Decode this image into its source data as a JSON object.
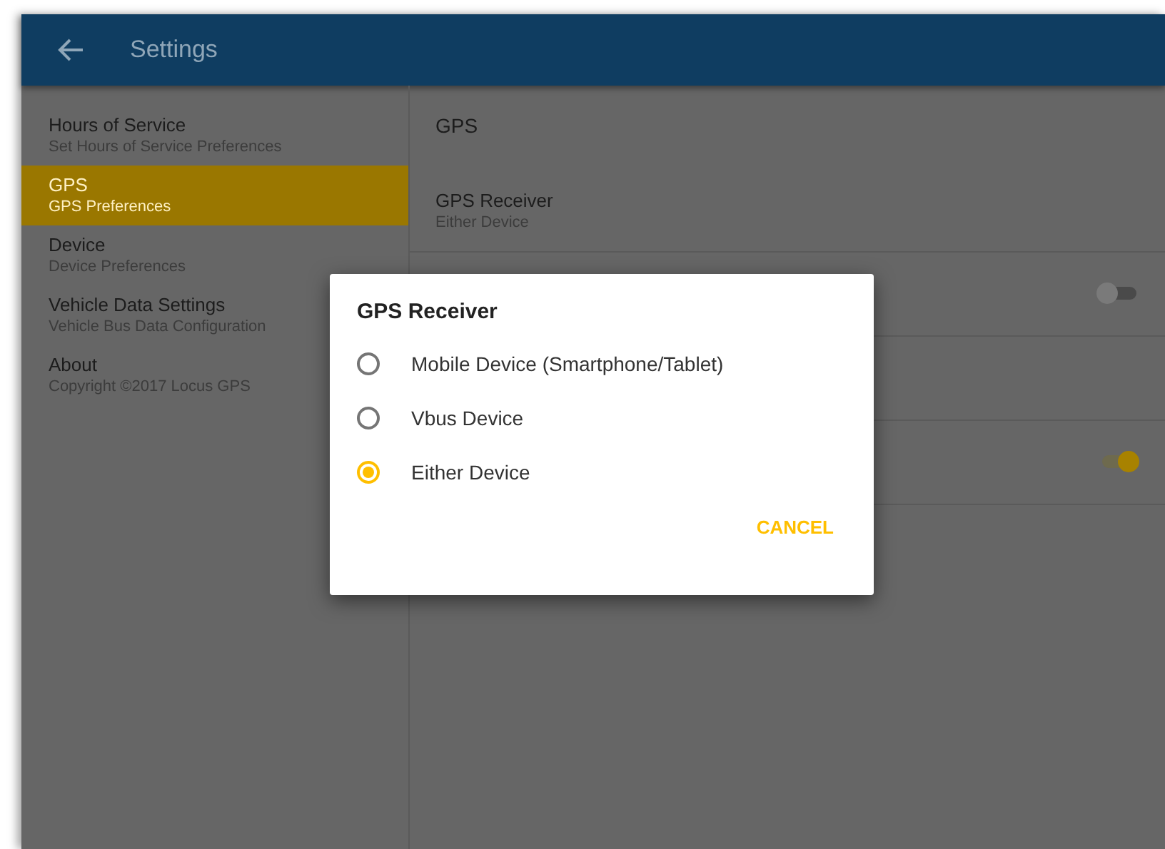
{
  "app_bar": {
    "title": "Settings"
  },
  "sidebar": {
    "items": [
      {
        "title": "Hours of Service",
        "subtitle": "Set Hours of Service Preferences",
        "selected": false
      },
      {
        "title": "GPS",
        "subtitle": "GPS Preferences",
        "selected": true
      },
      {
        "title": "Device",
        "subtitle": "Device Preferences",
        "selected": false
      },
      {
        "title": "Vehicle Data Settings",
        "subtitle": "Vehicle Bus Data Configuration",
        "selected": false
      },
      {
        "title": "About",
        "subtitle": "Copyright ©2017 Locus GPS",
        "selected": false
      }
    ]
  },
  "content": {
    "heading": "GPS",
    "rows": [
      {
        "kind": "text",
        "title": "GPS Receiver",
        "subtitle": "Either Device"
      },
      {
        "kind": "switch",
        "on": false
      },
      {
        "kind": "blank"
      },
      {
        "kind": "switch",
        "on": true
      }
    ]
  },
  "dialog": {
    "title": "GPS Receiver",
    "options": [
      {
        "label": "Mobile Device (Smartphone/Tablet)",
        "selected": false
      },
      {
        "label": "Vbus Device",
        "selected": false
      },
      {
        "label": "Either Device",
        "selected": true
      }
    ],
    "button": "CANCEL"
  }
}
